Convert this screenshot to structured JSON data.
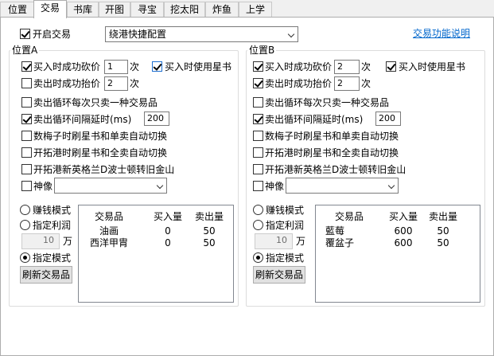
{
  "tabs": [
    {
      "label": "位置"
    },
    {
      "label": "交易"
    },
    {
      "label": "书库"
    },
    {
      "label": "开图"
    },
    {
      "label": "寻宝"
    },
    {
      "label": "挖太阳"
    },
    {
      "label": "炸鱼"
    },
    {
      "label": "上学"
    }
  ],
  "top": {
    "enable_label": "开启交易",
    "enable_checked": true,
    "config_value": "绕港快捷配置",
    "help_link": "交易功能说明"
  },
  "positions": [
    {
      "title": "位置A",
      "buy_bargain_label": "买入时成功砍价",
      "buy_bargain_value": "1",
      "buy_bargain_unit": "次",
      "use_star_label": "买入时使用星书",
      "sell_raise_label": "卖出时成功抬价",
      "sell_raise_value": "2",
      "sell_raise_unit": "次",
      "one_item_label": "卖出循环每次只卖一种交易品",
      "interval_label": "卖出循环间隔延时(ms)",
      "interval_value": "200",
      "plum_label": "数梅子时刷星书和单卖自动切换",
      "port_label": "开拓港时刷星书和全卖自动切换",
      "ng_label": "开拓港新英格兰D波士顿转旧金山",
      "statue_label": "神像",
      "statue_value": "",
      "mode_earn": "赚钱模式",
      "mode_profit": "指定利润",
      "profit_value": "10",
      "profit_unit": "万",
      "mode_specified": "指定模式",
      "refresh_button": "刷新交易品",
      "table_headers": [
        "交易品",
        "买入量",
        "卖出量"
      ],
      "table_rows": [
        [
          "油画",
          "0",
          "50"
        ],
        [
          "西洋甲胄",
          "0",
          "50"
        ]
      ]
    },
    {
      "title": "位置B",
      "buy_bargain_label": "买入时成功砍价",
      "buy_bargain_value": "2",
      "buy_bargain_unit": "次",
      "use_star_label": "买入时使用星书",
      "sell_raise_label": "卖出时成功抬价",
      "sell_raise_value": "2",
      "sell_raise_unit": "次",
      "one_item_label": "卖出循环每次只卖一种交易品",
      "interval_label": "卖出循环间隔延时(ms)",
      "interval_value": "200",
      "plum_label": "数梅子时刷星书和单卖自动切换",
      "port_label": "开拓港时刷星书和全卖自动切换",
      "ng_label": "开拓港新英格兰D波士顿转旧金山",
      "statue_label": "神像",
      "statue_value": "",
      "mode_earn": "赚钱模式",
      "mode_profit": "指定利润",
      "profit_value": "10",
      "profit_unit": "万",
      "mode_specified": "指定模式",
      "refresh_button": "刷新交易品",
      "table_headers": [
        "交易品",
        "买入量",
        "卖出量"
      ],
      "table_rows": [
        [
          "藍莓",
          "600",
          "50"
        ],
        [
          "覆盆子",
          "600",
          "50"
        ]
      ]
    }
  ]
}
